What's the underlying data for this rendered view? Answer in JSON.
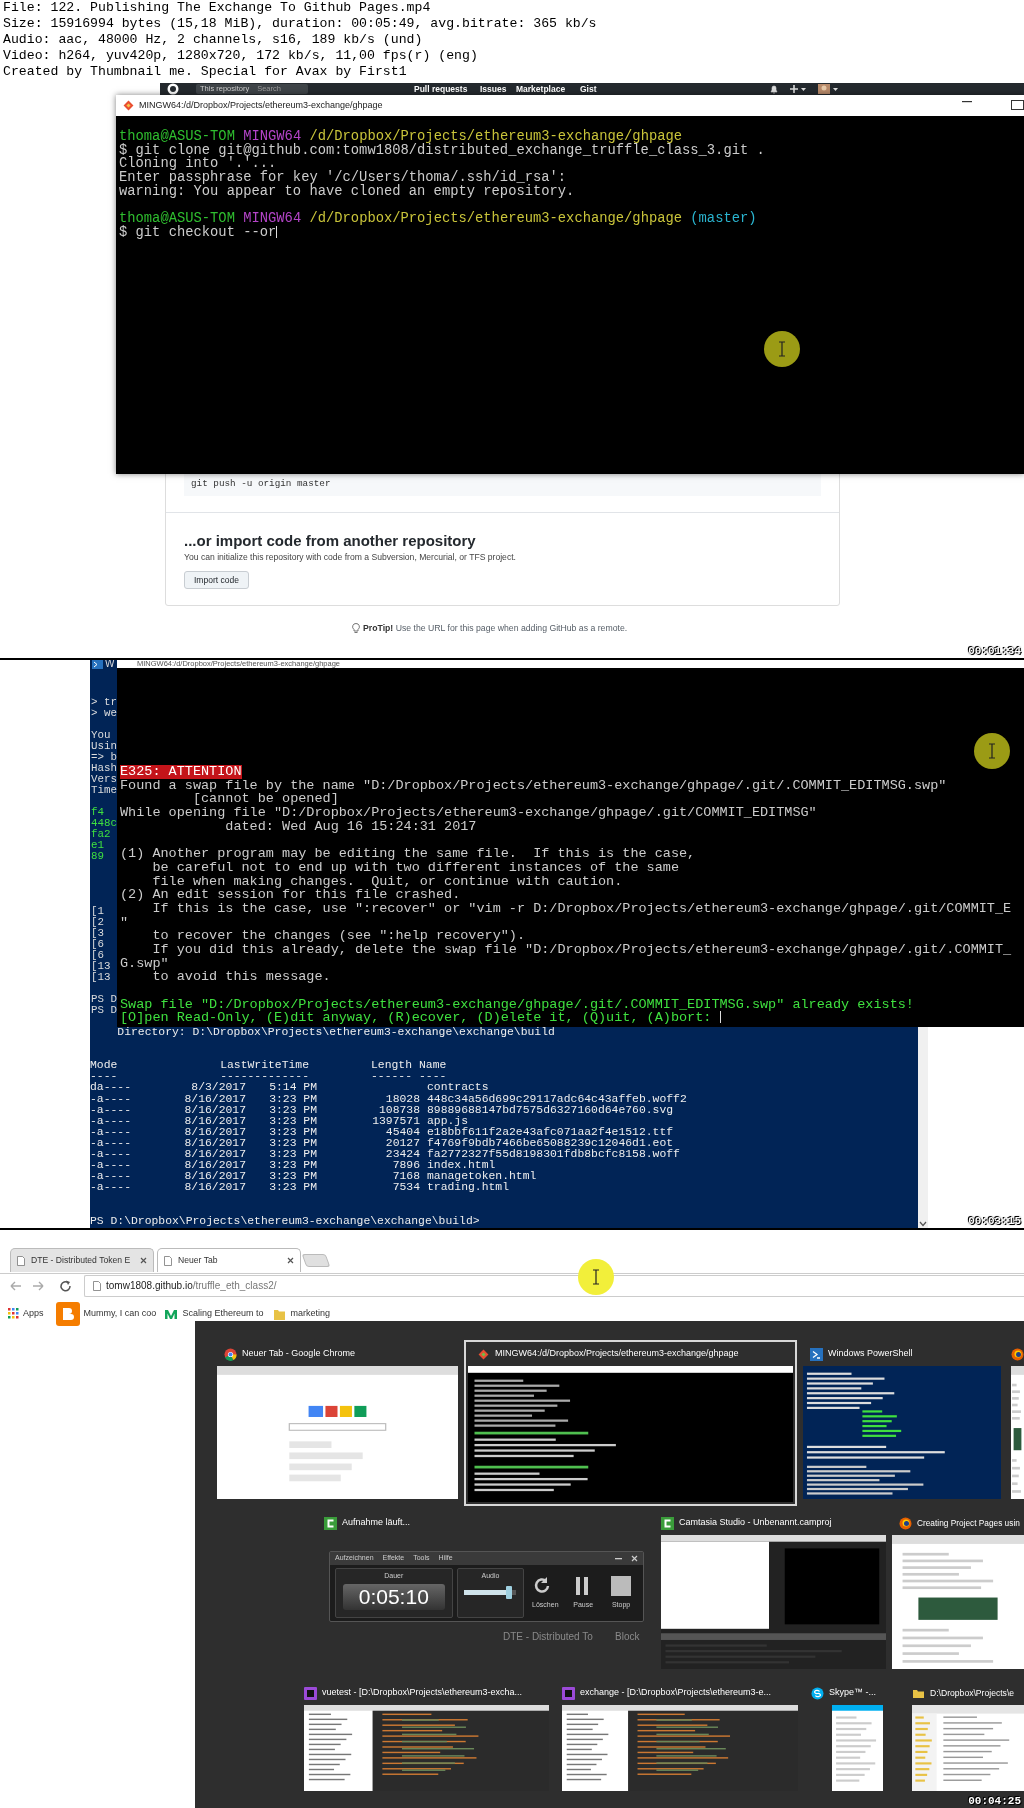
{
  "file_info": [
    "File: 122. Publishing The Exchange To Github Pages.mp4",
    "Size: 15916994 bytes (15,18 MiB), duration: 00:05:49, avg.bitrate: 365 kb/s",
    "Audio: aac, 48000 Hz, 2 channels, s16, 189 kb/s (und)",
    "Video: h264, yuv420p, 1280x720, 172 kb/s, 11,00 fps(r) (eng)",
    "Created by Thumbnail me. Special for Avax by First1"
  ],
  "frames": [
    {
      "kind": "github_terminal",
      "timestamp": "00:01:34",
      "github_header": {
        "scope": "This repository",
        "search_placeholder": "Search",
        "links": [
          "Pull requests",
          "Issues",
          "Marketplace",
          "Gist"
        ]
      },
      "terminal": {
        "title": "MINGW64:/d/Dropbox/Projects/ethereum3-exchange/ghpage",
        "lines": [
          {
            "kind": "prompt",
            "segments": [
              {
                "kind": "user",
                "text": "thoma@ASUS-TOM "
              },
              {
                "kind": "host",
                "text": "MINGW64 "
              },
              {
                "kind": "path",
                "text": "/d/Dropbox/Projects/ethereum3-exchange/ghpage"
              }
            ]
          },
          {
            "kind": "text",
            "text": "$ git clone git@github.com:tomw1808/distributed_exchange_truffle_class_3.git ."
          },
          {
            "kind": "text",
            "text": "Cloning into '.'..."
          },
          {
            "kind": "text",
            "text": "Enter passphrase for key '/c/Users/thoma/.ssh/id_rsa':"
          },
          {
            "kind": "text",
            "text": "warning: You appear to have cloned an empty repository."
          },
          {
            "kind": "blank"
          },
          {
            "kind": "prompt",
            "segments": [
              {
                "kind": "user",
                "text": "thoma@ASUS-TOM "
              },
              {
                "kind": "host",
                "text": "MINGW64 "
              },
              {
                "kind": "path",
                "text": "/d/Dropbox/Projects/ethereum3-exchange/ghpage "
              },
              {
                "kind": "branch",
                "text": "(master)"
              }
            ]
          },
          {
            "kind": "text",
            "text": "$ git checkout --or",
            "cursor": true
          }
        ]
      },
      "github_page": {
        "code": "git push -u origin master",
        "import_heading": "...or import code from another repository",
        "import_text": "You can initialize this repository with code from a Subversion, Mercurial, or TFS project.",
        "import_button": "Import code",
        "protip": "**ProTip!** Use the URL for this page when adding GitHub as a remote."
      }
    },
    {
      "kind": "vim_powershell",
      "timestamp": "00:03:15",
      "powershell": {
        "title": "W",
        "fragment_blocks": [
          {
            "kind": "text",
            "lines": [
              "> tr",
              "> we"
            ]
          },
          {
            "kind": "text",
            "lines": [
              "You",
              "Usin",
              "=> b",
              "Hash",
              "Vers",
              "Time"
            ]
          },
          {
            "kind": "hash",
            "lines": [
              "f4",
              "448c",
              "fa2",
              "e1",
              "89"
            ]
          },
          {
            "kind": "text",
            "lines": [
              "[1",
              "[2",
              "[3",
              "[6",
              "[6",
              "[13",
              "[13"
            ]
          },
          {
            "kind": "text",
            "lines": [
              "PS D",
              "PS D"
            ]
          }
        ],
        "directory": "Directory: D:\\Dropbox\\Projects\\ethereum3-exchange\\exchange\\build",
        "table": {
          "columns": [
            "Mode",
            "LastWriteTime",
            "Length",
            "Name"
          ],
          "dashes": [
            "----",
            "-------------",
            "------",
            "----"
          ],
          "rows": [
            {
              "mode": "da----",
              "date": "8/3/2017",
              "time": "5:14 PM",
              "name": "contracts"
            },
            {
              "mode": "-a----",
              "date": "8/16/2017",
              "time": "3:23 PM",
              "length": "18028",
              "name": "448c34a56d699c29117adc64c43affeb.woff2"
            },
            {
              "mode": "-a----",
              "date": "8/16/2017",
              "time": "3:23 PM",
              "length": "108738",
              "name": "89889688147bd7575d6327160d64e760.svg"
            },
            {
              "mode": "-a----",
              "date": "8/16/2017",
              "time": "3:23 PM",
              "length": "1397571",
              "name": "app.js"
            },
            {
              "mode": "-a----",
              "date": "8/16/2017",
              "time": "3:23 PM",
              "length": "45404",
              "name": "e18bbf611f2a2e43afc071aa2f4e1512.ttf"
            },
            {
              "mode": "-a----",
              "date": "8/16/2017",
              "time": "3:23 PM",
              "length": "20127",
              "name": "f4769f9bdb7466be65088239c12046d1.eot"
            },
            {
              "mode": "-a----",
              "date": "8/16/2017",
              "time": "3:23 PM",
              "length": "23424",
              "name": "fa2772327f55d8198301fdb8bcfc8158.woff"
            },
            {
              "mode": "-a----",
              "date": "8/16/2017",
              "time": "3:23 PM",
              "length": "7896",
              "name": "index.html"
            },
            {
              "mode": "-a----",
              "date": "8/16/2017",
              "time": "3:23 PM",
              "length": "7168",
              "name": "managetoken.html"
            },
            {
              "mode": "-a----",
              "date": "8/16/2017",
              "time": "3:23 PM",
              "length": "7534",
              "name": "trading.html"
            }
          ]
        },
        "prompt": "PS D:\\Dropbox\\Projects\\ethereum3-exchange\\exchange\\build>"
      },
      "vim": {
        "title": "MINGW64:/d/Dropbox/Projects/ethereum3-exchange/ghpage",
        "lines": [
          {
            "kind": "error",
            "text": "E325: ATTENTION"
          },
          {
            "kind": "text",
            "text": "Found a swap file by the name \"D:/Dropbox/Projects/ethereum3-exchange/ghpage/.git/.COMMIT_EDITMSG.swp\""
          },
          {
            "kind": "text",
            "text": "         [cannot be opened]"
          },
          {
            "kind": "text",
            "text": "While opening file \"D:/Dropbox/Projects/ethereum3-exchange/ghpage/.git/COMMIT_EDITMSG\""
          },
          {
            "kind": "text",
            "text": "             dated: Wed Aug 16 15:24:31 2017"
          },
          {
            "kind": "blank"
          },
          {
            "kind": "text",
            "text": "(1) Another program may be editing the same file.  If this is the case,"
          },
          {
            "kind": "text",
            "text": "    be careful not to end up with two different instances of the same"
          },
          {
            "kind": "text",
            "text": "    file when making changes.  Quit, or continue with caution."
          },
          {
            "kind": "text",
            "text": "(2) An edit session for this file crashed."
          },
          {
            "kind": "text",
            "text": "    If this is the case, use \":recover\" or \"vim -r D:/Dropbox/Projects/ethereum3-exchange/ghpage/.git/COMMIT_E"
          },
          {
            "kind": "text",
            "text": "\""
          },
          {
            "kind": "text",
            "text": "    to recover the changes (see \":help recovery\")."
          },
          {
            "kind": "text",
            "text": "    If you did this already, delete the swap file \"D:/Dropbox/Projects/ethereum3-exchange/ghpage/.git/.COMMIT_"
          },
          {
            "kind": "text",
            "text": "G.swp\""
          },
          {
            "kind": "text",
            "text": "    to avoid this message."
          },
          {
            "kind": "blank"
          },
          {
            "kind": "notice",
            "text": "Swap file \"D:/Dropbox/Projects/ethereum3-exchange/ghpage/.git/.COMMIT_EDITMSG.swp\" already exists!"
          },
          {
            "kind": "notice",
            "text": "[O]pen Read-Only, (E)dit anyway, (R)ecover, (D)elete it, (Q)uit, (A)bort: ",
            "cursor": true
          }
        ]
      }
    },
    {
      "kind": "task_switcher",
      "timestamp": "00:04:25",
      "browser": {
        "tabs": [
          {
            "title": "DTE - Distributed Token E",
            "selected": false
          },
          {
            "title": "Neuer Tab",
            "selected": true
          }
        ],
        "url_host": "tomw1808.github.io",
        "url_path": "/truffle_eth_class2/",
        "bookmarks": [
          {
            "kind": "apps",
            "label": "Apps"
          },
          {
            "kind": "blogger",
            "label": "Mummy, I can coo"
          },
          {
            "kind": "medium",
            "label": "Scaling Ethereum to"
          },
          {
            "kind": "folder",
            "label": "marketing"
          }
        ]
      },
      "switcher": {
        "background_texts": [
          "DTE - Distributed To",
          "Block"
        ],
        "windows": [
          {
            "kind": "chrome",
            "title": "Neuer Tab - Google Chrome",
            "selected": false
          },
          {
            "kind": "git",
            "title": "MINGW64:/d/Dropbox/Projects/ethereum3-exchange/ghpage",
            "selected": true
          },
          {
            "kind": "powershell",
            "title": "Windows PowerShell",
            "selected": false
          },
          {
            "kind": "firefox",
            "selected": false
          },
          {
            "kind": "recorder",
            "title": "Aufnahme läuft...",
            "selected": false
          },
          {
            "kind": "camtasia",
            "title": "Camtasia Studio - Unbenannt.camproj",
            "selected": false
          },
          {
            "kind": "firefox",
            "title": "Creating Project Pages usin",
            "selected": false
          },
          {
            "kind": "phpstorm",
            "title": "vuetest - [D:\\Dropbox\\Projects\\ethereum3-excha...",
            "selected": false
          },
          {
            "kind": "phpstorm",
            "title": "exchange - [D:\\Dropbox\\Projects\\ethereum3-e...",
            "selected": false
          },
          {
            "kind": "skype",
            "title": "Skype™ -...",
            "selected": false
          },
          {
            "kind": "folder",
            "title": "D:\\Dropbox\\Projects\\e",
            "selected": false
          }
        ],
        "recorder": {
          "menu": [
            "Aufzeichnen",
            "Effekte",
            "Tools",
            "Hilfe"
          ],
          "duration_label": "Dauer",
          "duration": "0:05:10",
          "audio": {
            "label": "Audio",
            "level": 0.85
          },
          "buttons": [
            {
              "kind": "delete",
              "label": "Löschen"
            },
            {
              "kind": "pause",
              "label": "Pause"
            },
            {
              "kind": "stop",
              "label": "Stopp"
            }
          ]
        }
      }
    }
  ]
}
